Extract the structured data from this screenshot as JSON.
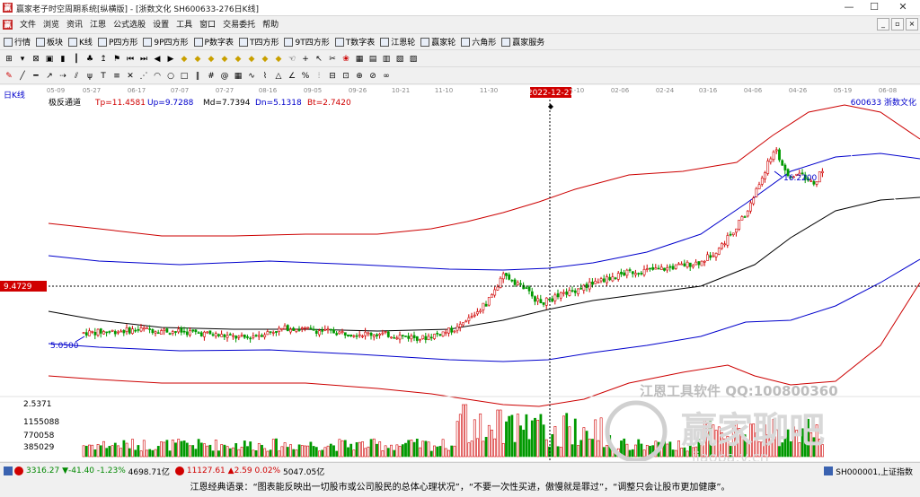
{
  "window": {
    "title": "赢家老子时空周期系统[纵横版] - [浙数文化  SH600633-276日K线]",
    "minimize": "—",
    "maximize": "☐",
    "close": "✕"
  },
  "menu": [
    "文件",
    "浏览",
    "资讯",
    "江恩",
    "公式选股",
    "设置",
    "工具",
    "窗口",
    "交易委托",
    "帮助"
  ],
  "toolbar": [
    {
      "label": "行情",
      "icon": "grid-icon"
    },
    {
      "label": "板块",
      "icon": "block-icon"
    },
    {
      "label": "K线",
      "icon": "candle-icon"
    },
    {
      "label": "P四方形",
      "icon": "p-square-icon"
    },
    {
      "label": "9P四方形",
      "icon": "9p-square-icon"
    },
    {
      "label": "P数字表",
      "icon": "p-table-icon"
    },
    {
      "label": "T四方形",
      "icon": "t-square-icon"
    },
    {
      "label": "9T四方形",
      "icon": "9t-square-icon"
    },
    {
      "label": "T数字表",
      "icon": "t-table-icon"
    },
    {
      "label": "江恩轮",
      "icon": "gann-wheel-icon"
    },
    {
      "label": "赢家轮",
      "icon": "winner-wheel-icon"
    },
    {
      "label": "六角形",
      "icon": "hexagon-icon"
    },
    {
      "label": "赢家服务",
      "icon": "service-icon"
    }
  ],
  "chart": {
    "period_label": "日K线",
    "indicator_name": "极反通道",
    "tp": "Tp=11.4581",
    "up": "Up=9.7288",
    "md": "Md=7.7394",
    "dn": "Dn=5.1318",
    "bt": "Bt=2.7420",
    "code_name": "600633  浙数文化",
    "crosshair_date": "2022-12-27",
    "crosshair_price": "9.4729",
    "high_label": "16.2200",
    "low_label": "5.0500",
    "vol_max": "2.5371",
    "vol_ticks": [
      "1155088",
      "770058",
      "385029"
    ],
    "date_ticks": [
      "05-09",
      "05-27",
      "06-17",
      "07-07",
      "07-27",
      "08-16",
      "09-05",
      "09-26",
      "10-21",
      "11-10",
      "11-30",
      "01-10",
      "02-06",
      "02-24",
      "03-16",
      "04-06",
      "04-26",
      "05-19",
      "06-08"
    ],
    "watermark": "江恩工具软件  QQ:100800360",
    "watermark_logo": "赢家聊吧",
    "watermark_url": "jiaoba.v.cn"
  },
  "chart_data": {
    "type": "candlestick",
    "title": "浙数文化 SH600633 日K线",
    "price_range": [
      2.0,
      18.0
    ],
    "start_price": 5.3,
    "high": 16.22,
    "low": 5.05,
    "volume_max": 2.5371
  },
  "statusbar": {
    "sh_value": "3316.27",
    "sh_change": "▼-41.40",
    "sh_pct": "-1.23%",
    "sh_amount": "4698.71亿",
    "sz_value": "11127.61",
    "sz_change": "▲2.59",
    "sz_pct": "0.02%",
    "sz_amount": "5047.05亿",
    "right_index": "SH000001,上证指数"
  },
  "quote": "江恩经典语录：“图表能反映出一切股市或公司股民的总体心理状况”，“不要一次性买进，傲慢就是罪过”，“调整只会让股市更加健康”。",
  "colors": {
    "up": "#d00000",
    "down": "#009900",
    "band_outer": "#cc0000",
    "band_inner": "#0000cc",
    "mid": "#000000"
  }
}
